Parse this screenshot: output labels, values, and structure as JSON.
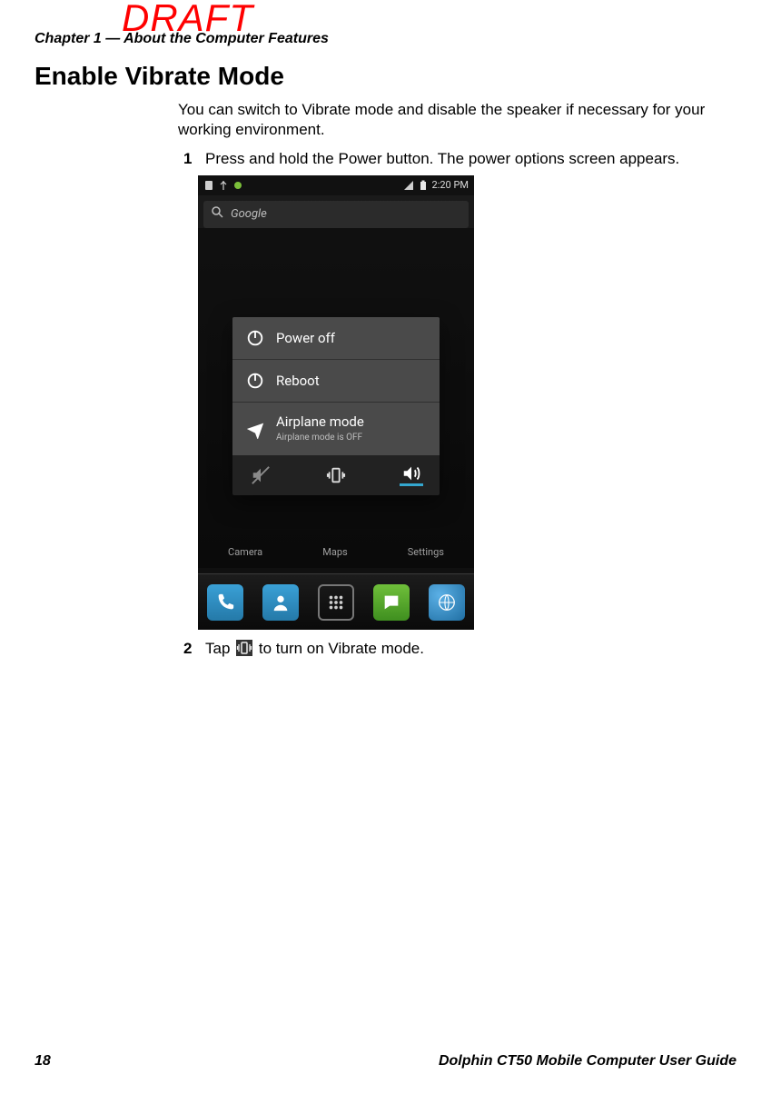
{
  "watermark": "DRAFT",
  "running_head": "Chapter 1 — About the Computer Features",
  "section_title": "Enable Vibrate Mode",
  "intro": "You can switch to Vibrate mode and disable the speaker if necessary for your working environment.",
  "steps": {
    "s1": {
      "num": "1",
      "text": "Press and hold the Power button. The power options screen appears."
    },
    "s2": {
      "num": "2",
      "before": "Tap ",
      "after": " to turn on Vibrate mode."
    }
  },
  "phone": {
    "status": {
      "time": "2:20 PM"
    },
    "search_placeholder": "Google",
    "menu": {
      "power_off": "Power off",
      "reboot": "Reboot",
      "airplane": "Airplane mode",
      "airplane_sub": "Airplane mode is OFF"
    },
    "app_labels": {
      "camera": "Camera",
      "maps": "Maps",
      "settings": "Settings"
    }
  },
  "footer": {
    "page": "18",
    "guide": "Dolphin CT50 Mobile Computer User Guide"
  },
  "colors": {
    "draft": "#ff0000",
    "highlight": "#34a7cf"
  }
}
